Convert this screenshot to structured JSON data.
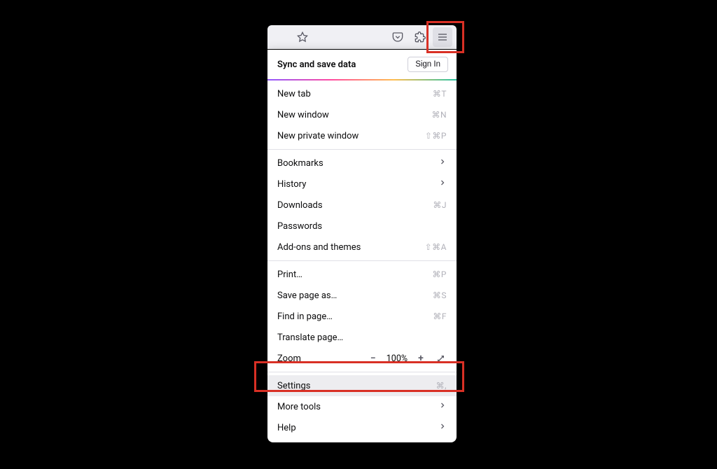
{
  "header": {
    "sync_title": "Sync and save data",
    "signin_label": "Sign In"
  },
  "group1": [
    {
      "label": "New tab",
      "shortcut": "⌘T"
    },
    {
      "label": "New window",
      "shortcut": "⌘N"
    },
    {
      "label": "New private window",
      "shortcut": "⇧⌘P"
    }
  ],
  "group2": [
    {
      "label": "Bookmarks",
      "chevron": true
    },
    {
      "label": "History",
      "chevron": true
    },
    {
      "label": "Downloads",
      "shortcut": "⌘J"
    },
    {
      "label": "Passwords"
    },
    {
      "label": "Add-ons and themes",
      "shortcut": "⇧⌘A"
    }
  ],
  "group3": [
    {
      "label": "Print…",
      "shortcut": "⌘P"
    },
    {
      "label": "Save page as…",
      "shortcut": "⌘S"
    },
    {
      "label": "Find in page…",
      "shortcut": "⌘F"
    },
    {
      "label": "Translate page…"
    }
  ],
  "zoom": {
    "label": "Zoom",
    "value": "100%"
  },
  "group4": [
    {
      "label": "Settings",
      "shortcut": "⌘,",
      "highlighted": true
    },
    {
      "label": "More tools",
      "chevron": true
    },
    {
      "label": "Help",
      "chevron": true
    }
  ]
}
